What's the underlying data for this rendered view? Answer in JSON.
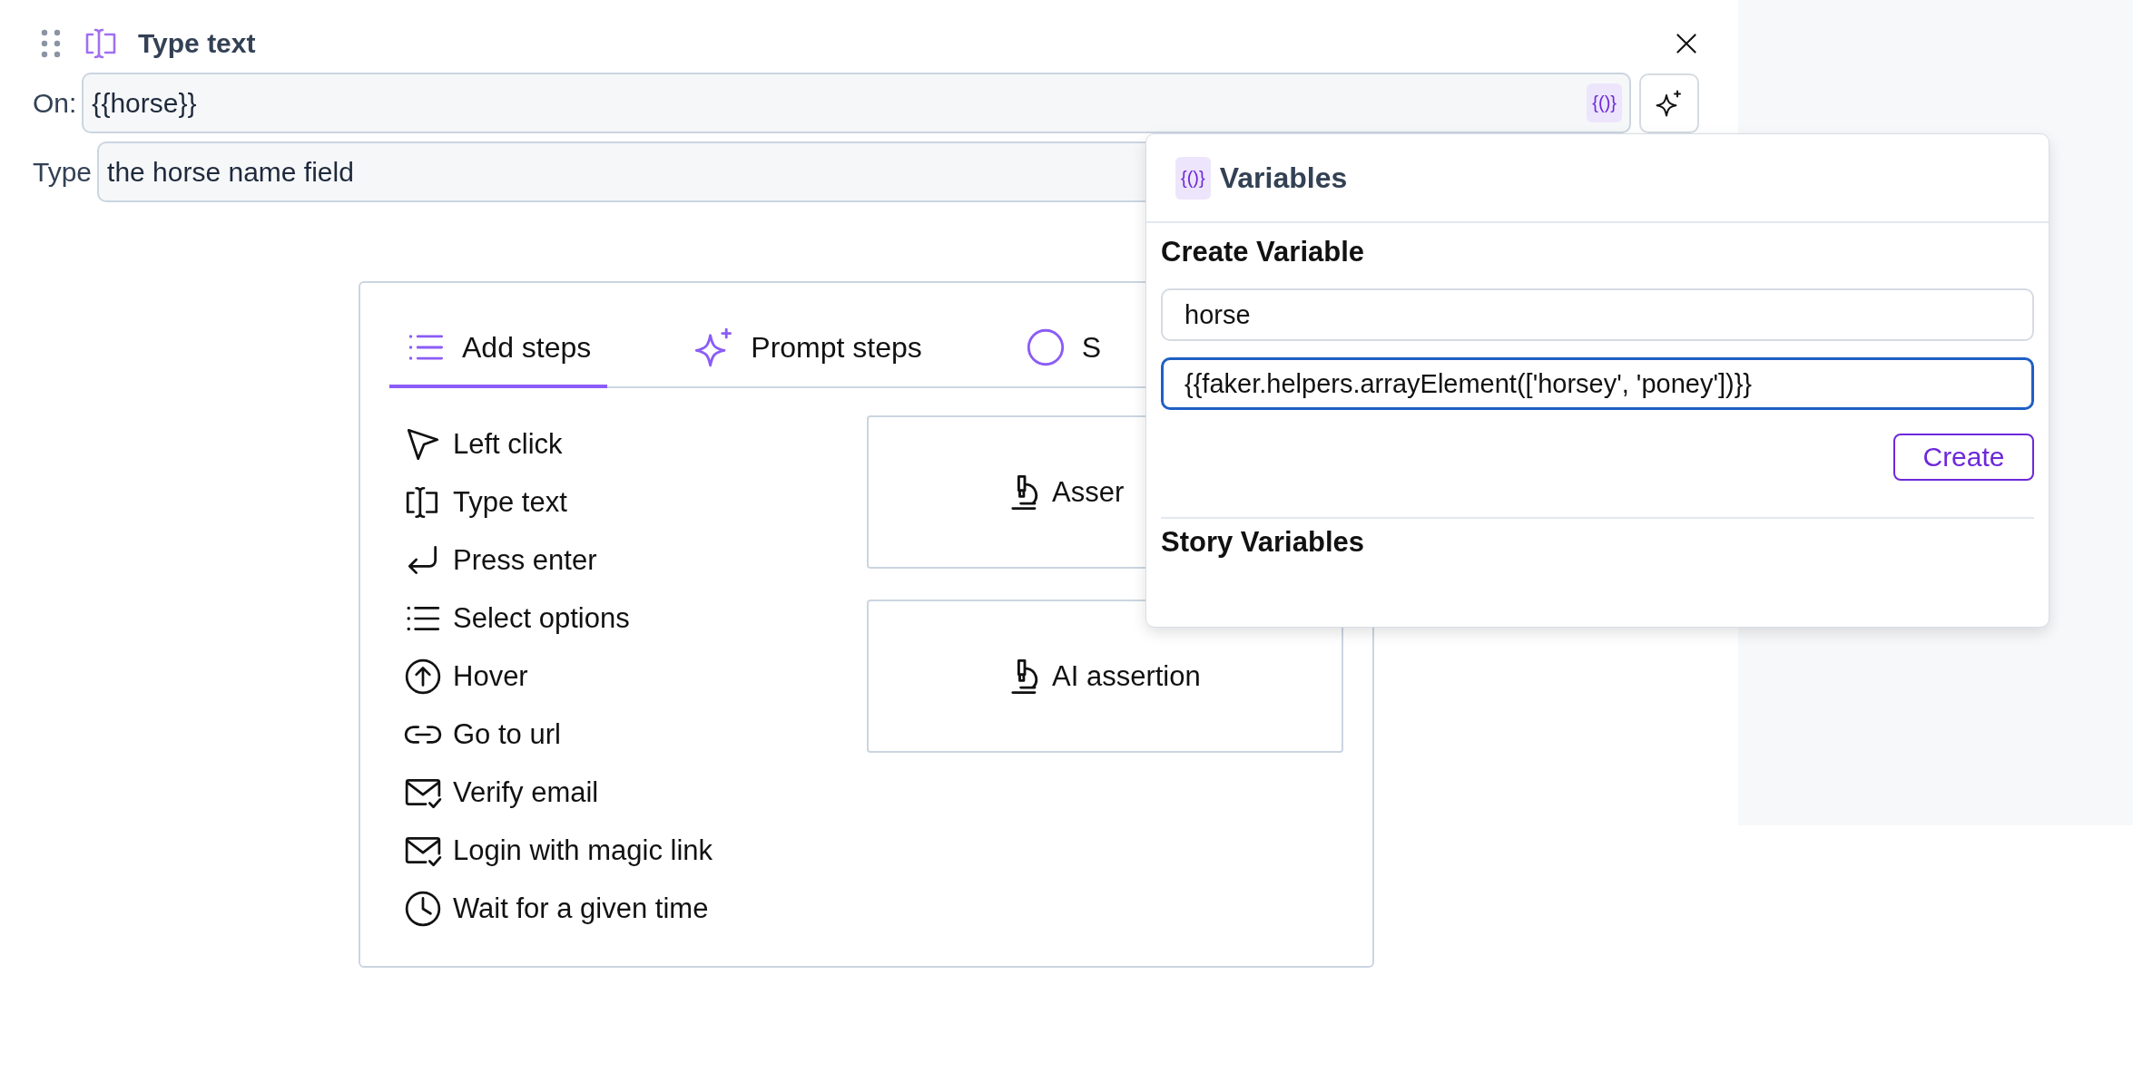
{
  "step": {
    "title": "Type text",
    "on_label": "On:",
    "on_value": "{{horse}}",
    "variable_button": "{()}",
    "type_label": "Type",
    "type_value": "the horse name field"
  },
  "add_panel": {
    "tabs": [
      {
        "label": "Add steps",
        "selected": true
      },
      {
        "label": "Prompt steps",
        "selected": false
      },
      {
        "label": "S",
        "selected": false
      }
    ],
    "actions": [
      {
        "label": "Left click"
      },
      {
        "label": "Type text"
      },
      {
        "label": "Press enter"
      },
      {
        "label": "Select options"
      },
      {
        "label": "Hover"
      },
      {
        "label": "Go to url"
      },
      {
        "label": "Verify email"
      },
      {
        "label": "Login with magic link"
      },
      {
        "label": "Wait for a given time"
      }
    ],
    "cards": [
      {
        "label": "Asser"
      },
      {
        "label": "AI assertion"
      }
    ]
  },
  "variables_popup": {
    "icon_text": "{()}",
    "title": "Variables",
    "create_heading": "Create Variable",
    "fields": [
      {
        "value": "horse",
        "focused": false
      },
      {
        "value": "{{faker.helpers.arrayElement(['horsey', 'poney'])}}",
        "focused": true
      }
    ],
    "create_button": "Create",
    "story_heading": "Story Variables"
  }
}
